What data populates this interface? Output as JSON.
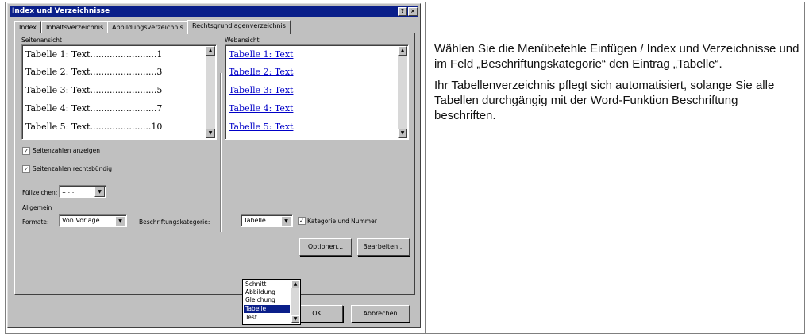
{
  "dialog": {
    "title": "Index und Verzeichnisse",
    "tabs": [
      "Index",
      "Inhaltsverzeichnis",
      "Abbildungsverzeichnis",
      "Rechtsgrundlagenverzeichnis"
    ],
    "print_preview_label": "Seitenansicht",
    "web_preview_label": "Webansicht",
    "print_preview": [
      {
        "text": "Tabelle 1: Text",
        "dots": "........................",
        "page": "1"
      },
      {
        "text": "Tabelle 2: Text",
        "dots": "........................",
        "page": "3"
      },
      {
        "text": "Tabelle 3: Text",
        "dots": "........................",
        "page": "5"
      },
      {
        "text": "Tabelle 4: Text",
        "dots": "........................",
        "page": "7"
      },
      {
        "text": "Tabelle 5: Text",
        "dots": "......................",
        "page": "10"
      }
    ],
    "web_preview": [
      "Tabelle 1: Text",
      "Tabelle 2: Text",
      "Tabelle 3: Text",
      "Tabelle 4: Text",
      "Tabelle 5: Text"
    ],
    "show_page_numbers": "Seitenzahlen anzeigen",
    "right_align_page_numbers": "Seitenzahlen rechtsbündig",
    "tab_leader_label": "Füllzeichen:",
    "tab_leader_value": ".......",
    "general_label": "Allgemein",
    "formats_label": "Formate:",
    "formats_value": "Von Vorlage",
    "caption_label_label": "Beschriftungskategorie:",
    "caption_label_value": "Tabelle",
    "include_label_number": "Kategorie und Nummer",
    "caption_options": [
      "Schnitt",
      "Abbildung",
      "Gleichung",
      "Tabelle",
      "Test"
    ],
    "caption_selected": "Tabelle",
    "options_button": "Optionen...",
    "modify_button": "Bearbeiten...",
    "ok_button": "OK",
    "cancel_button": "Abbrechen"
  },
  "instructions": {
    "para1": "Wählen Sie die Menübefehle Einfügen / Index und Verzeichnisse und im Feld „Beschriftungskategorie“ den Eintrag „Tabelle“.",
    "para2": "Ihr Tabellenverzeichnis pflegt sich automatisiert, solange Sie alle Tabellen durchgängig mit der Word-Funktion Beschriftung beschriften."
  },
  "colors": {
    "titlebar": "#0a1f8a",
    "dialog_bg": "#c0c0c0",
    "link": "#0000c8"
  }
}
